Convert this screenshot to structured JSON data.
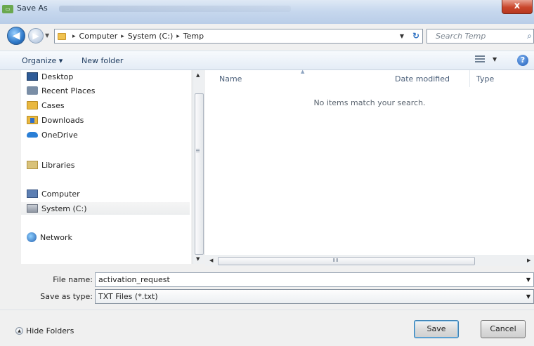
{
  "window": {
    "title": "Save As",
    "close_label": "x"
  },
  "address_bar": {
    "breadcrumbs": [
      "Computer",
      "System (C:)",
      "Temp"
    ],
    "separator": "▸"
  },
  "search": {
    "placeholder": "Search Temp"
  },
  "toolbar": {
    "organize_label": "Organize ▾",
    "new_folder_label": "New folder",
    "help_label": "?"
  },
  "nav_pane": {
    "items": [
      {
        "label": "Desktop",
        "icon": "desktop-icon"
      },
      {
        "label": "Recent Places",
        "icon": "recent-places-icon"
      },
      {
        "label": "Cases",
        "icon": "folder-icon"
      },
      {
        "label": "Downloads",
        "icon": "downloads-icon"
      },
      {
        "label": "OneDrive",
        "icon": "cloud-icon"
      },
      {
        "label": "Libraries",
        "icon": "libraries-icon"
      },
      {
        "label": "Computer",
        "icon": "computer-icon"
      },
      {
        "label": "System (C:)",
        "icon": "drive-icon",
        "selected": true
      },
      {
        "label": "Network",
        "icon": "network-icon"
      }
    ]
  },
  "file_list": {
    "columns": [
      "Name",
      "Date modified",
      "Type"
    ],
    "empty_message": "No items match your search."
  },
  "form": {
    "file_name_label": "File name:",
    "file_name_value": "activation_request",
    "save_type_label": "Save as type:",
    "save_type_value": "TXT Files (*.txt)"
  },
  "footer": {
    "hide_folders_label": "Hide Folders",
    "save_label": "Save",
    "cancel_label": "Cancel"
  },
  "colors": {
    "title_bar": "#c7d8ee",
    "close_button": "#c9462c",
    "accent": "#2b6fc2"
  }
}
